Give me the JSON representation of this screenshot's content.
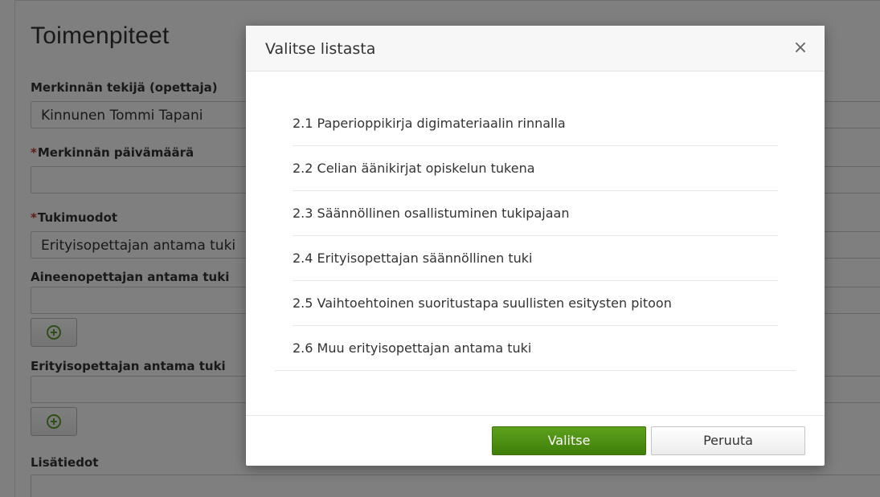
{
  "page": {
    "title": "Toimenpiteet",
    "fields": {
      "author_label": "Merkinnän tekijä (opettaja)",
      "author_value": "Kinnunen Tommi Tapani",
      "date_label": "Merkinnän päivämäärä",
      "support_forms_label": "Tukimuodot",
      "support_forms_value": "Erityisopettajan antama tuki",
      "subject_teacher_label": "Aineenopettajan antama tuki",
      "special_teacher_label": "Erityisopettajan antama tuki",
      "additional_info_label": "Lisätiedot",
      "required_mark": "*"
    }
  },
  "modal": {
    "title": "Valitse listasta",
    "close_glyph": "×",
    "items": [
      {
        "label": "2.1 Paperioppikirja digimateriaalin rinnalla"
      },
      {
        "label": "2.2 Celian äänikirjat opiskelun tukena"
      },
      {
        "label": "2.3 Säännöllinen osallistuminen tukipajaan"
      },
      {
        "label": "2.4 Erityisopettajan säännöllinen tuki"
      },
      {
        "label": "2.5 Vaihtoehtoinen suoritustapa suullisten esitysten pitoon"
      },
      {
        "label": "2.6 Muu erityisopettajan antama tuki"
      }
    ],
    "select_button": "Valitse",
    "cancel_button": "Peruuta"
  },
  "colors": {
    "primary": "#4a8c12",
    "required": "#c0392b",
    "plus_icon": "#5a9e2a"
  }
}
